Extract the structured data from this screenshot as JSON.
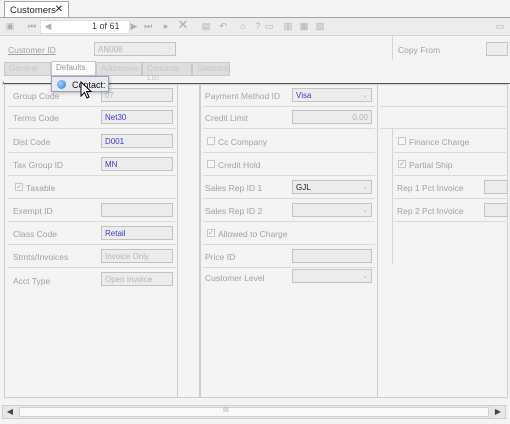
{
  "window": {
    "tab_title": "Customers",
    "close_glyph": "✕"
  },
  "toolbar": {
    "record_position": "1 of 61"
  },
  "header": {
    "customer_id_label": "Customer ID",
    "customer_id_value": "AN008",
    "copy_from_label": "Copy From"
  },
  "subtabs": [
    {
      "label": "General"
    },
    {
      "label": "Defaults"
    },
    {
      "label": "Addresses"
    },
    {
      "label": "Contacts List"
    },
    {
      "label": "Statistics"
    }
  ],
  "drag_tooltip": {
    "label": "Contact:"
  },
  "left": {
    "group_code": {
      "label": "Group Code",
      "value": "07"
    },
    "terms_code": {
      "label": "Terms Code",
      "value": "Net30"
    },
    "dist_code": {
      "label": "Dist Code",
      "value": "D001"
    },
    "tax_group_id": {
      "label": "Tax Group ID",
      "value": "MN"
    },
    "taxable": {
      "label": "Taxable",
      "checked": true
    },
    "exempt_id": {
      "label": "Exempt ID",
      "value": ""
    },
    "class_code": {
      "label": "Class Code",
      "value": "Retail"
    },
    "stmts_invoices": {
      "label": "Stmts/Invoices",
      "value": "Invoice Only"
    },
    "acct_type": {
      "label": "Acct Type",
      "value": "Open Invoice"
    }
  },
  "middle": {
    "payment_method_id": {
      "label": "Payment Method ID",
      "value": "Visa"
    },
    "credit_limit": {
      "label": "Credit Limit",
      "value": "0.00"
    },
    "cc_company": {
      "label": "Cc Company",
      "checked": false
    },
    "credit_hold": {
      "label": "Credit Hold",
      "checked": false
    },
    "sales_rep_id_1": {
      "label": "Sales Rep ID 1",
      "value": "GJL"
    },
    "sales_rep_id_2": {
      "label": "Sales Rep ID 2",
      "value": ""
    },
    "allowed_to_charge": {
      "label": "Allowed to Charge",
      "checked": false
    },
    "price_id": {
      "label": "Price ID",
      "value": ""
    },
    "customer_level": {
      "label": "Customer  Level",
      "value": ""
    }
  },
  "right": {
    "finance_charge": {
      "label": "Finance Charge",
      "checked": false
    },
    "partial_ship": {
      "label": "Partial Ship",
      "checked": true
    },
    "rep1_pct": {
      "label": "Rep 1 Pct Invoice",
      "value": ""
    },
    "rep2_pct": {
      "label": "Rep 2 Pct Invoice",
      "value": ""
    }
  },
  "scrollbar": {
    "grip": "III",
    "left_arrow": "◀",
    "right_arrow": "▶"
  }
}
